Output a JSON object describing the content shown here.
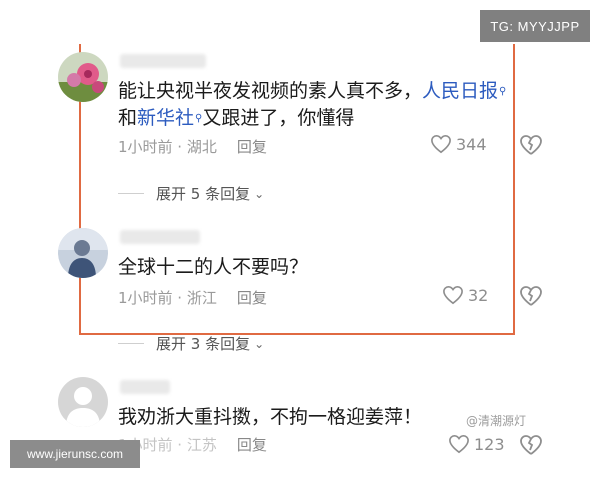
{
  "overlay": {
    "tg_badge": "TG: MYYJJPP",
    "site_badge": "www.jierunsc.com",
    "watermark": "@清潮源灯"
  },
  "comments": [
    {
      "text_before": "能让央视半夜发视频的素人真不多，",
      "link1": "人民日报",
      "text_mid1": "和",
      "link2": "新华社",
      "text_after": "又跟进了，你懂得",
      "time_location": "1小时前 · 湖北",
      "reply_label": "回复",
      "likes": "344",
      "expand_label": "展开 5 条回复"
    },
    {
      "text": "全球十二的人不要吗？",
      "time_location": "1小时前 · 浙江",
      "reply_label": "回复",
      "likes": "32",
      "expand_label": "展开 3 条回复"
    },
    {
      "text": "我劝浙大重抖擞，不拘一格迎姜萍！",
      "time_location": "1小时前 · 江苏",
      "reply_label": "回复",
      "likes": "123"
    }
  ],
  "colors": {
    "highlight": "#e06a42",
    "link": "#2c5bbf"
  }
}
